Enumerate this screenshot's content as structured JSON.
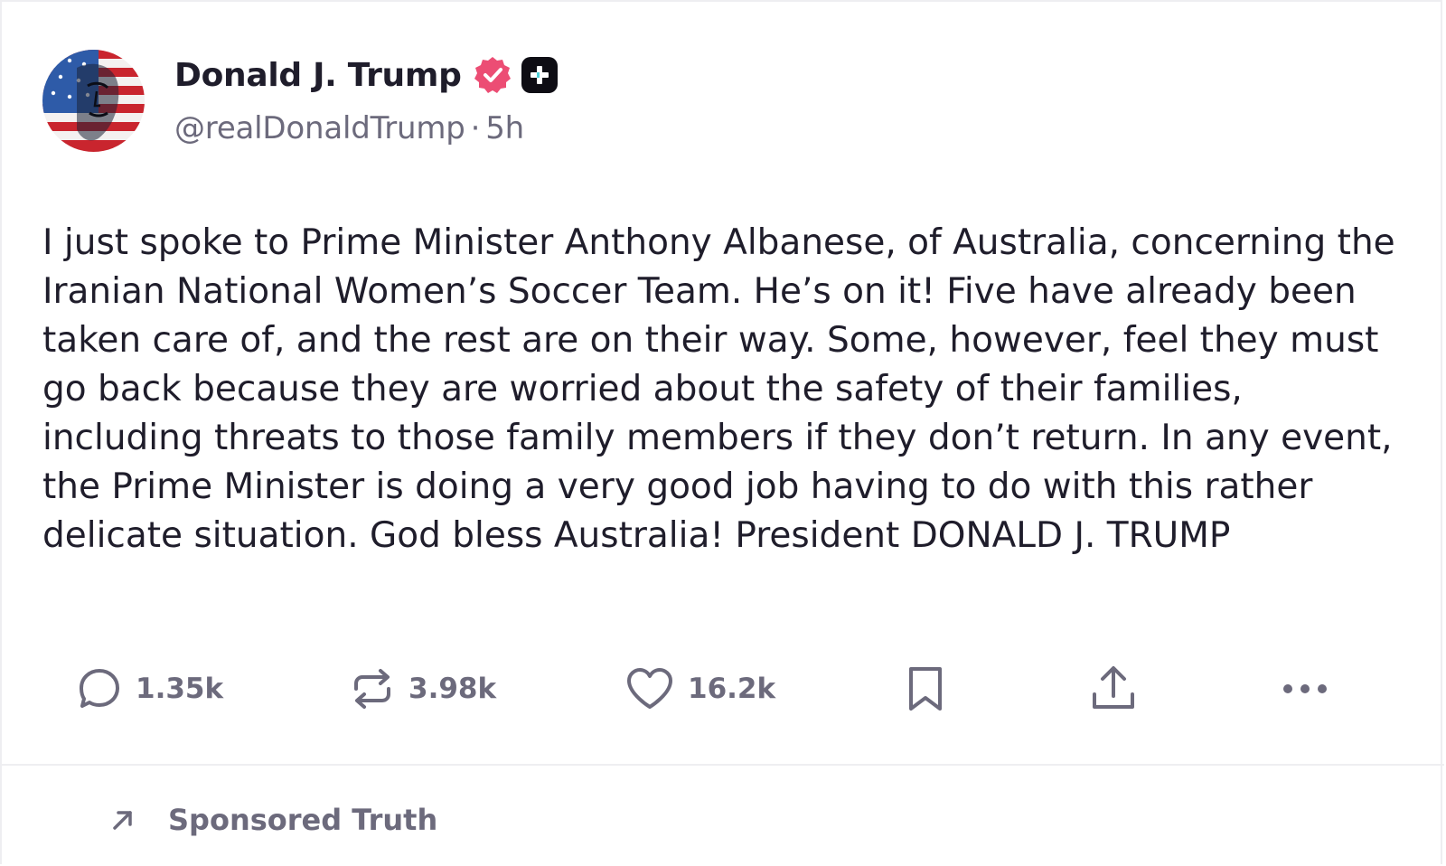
{
  "post": {
    "display_name": "Donald J. Trump",
    "handle": "@realDonaldTrump",
    "separator": "·",
    "timestamp": "5h",
    "text": "I just spoke to Prime Minister Anthony Albanese, of Australia, concerning the Iranian National Women’s Soccer Team. He’s on it! Five have already been taken care of, and the rest are on their way. Some, however, feel they must go back because they are worried about the safety of their families, including threats to those family members if they don’t return. In any event, the Prime Minister is doing a very good job having to do with this rather delicate situation. God bless Australia! President DONALD J. TRUMP",
    "avatar_icon": "american-flag-portrait",
    "verified_icon": "verified-badge-icon",
    "plus_icon": "truth-plus-badge-icon"
  },
  "actions": {
    "reply": {
      "icon": "reply-icon",
      "count": "1.35k"
    },
    "retruth": {
      "icon": "retruth-icon",
      "count": "3.98k"
    },
    "like": {
      "icon": "heart-icon",
      "count": "16.2k"
    },
    "bookmark": {
      "icon": "bookmark-icon"
    },
    "share": {
      "icon": "share-icon"
    },
    "more": {
      "icon": "more-icon"
    }
  },
  "sponsored": {
    "icon": "arrow-up-right-icon",
    "label": "Sponsored Truth"
  },
  "colors": {
    "text_primary": "#1f1d2b",
    "text_secondary": "#6c6a7c",
    "verified": "#ec4d74",
    "border": "#eeeef1"
  }
}
